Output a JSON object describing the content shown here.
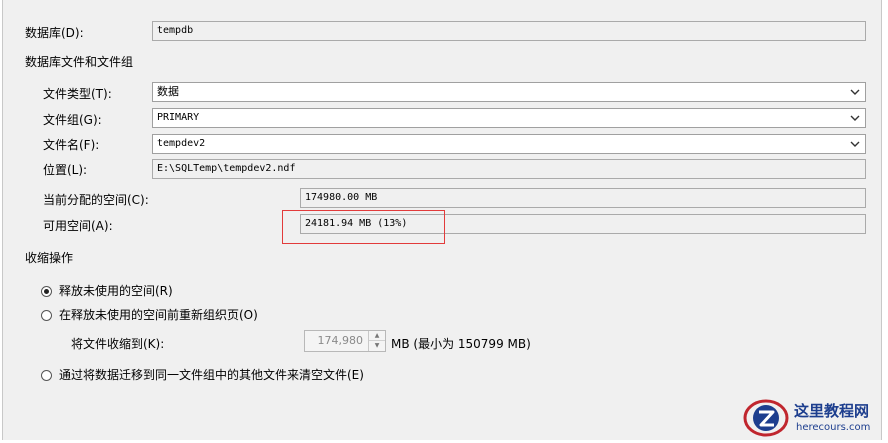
{
  "database": {
    "label": "数据库(D):",
    "value": "tempdb"
  },
  "files_section": {
    "title": "数据库文件和文件组"
  },
  "file_type": {
    "label": "文件类型(T):",
    "value": "数据"
  },
  "filegroup": {
    "label": "文件组(G):",
    "value": "PRIMARY"
  },
  "file_name": {
    "label": "文件名(F):",
    "value": "tempdev2"
  },
  "location": {
    "label": "位置(L):",
    "value": "E:\\SQLTemp\\tempdev2.ndf"
  },
  "allocated": {
    "label": "当前分配的空间(C):",
    "value": "174980.00 MB"
  },
  "available": {
    "label": "可用空间(A):",
    "value": "24181.94 MB (13%)"
  },
  "shrink_section": {
    "title": "收缩操作"
  },
  "options": {
    "release": {
      "label": "释放未使用的空间(R)",
      "selected": true
    },
    "reorganize": {
      "label": "在释放未使用的空间前重新组织页(O)",
      "selected": false
    },
    "shrink_to": {
      "label": "将文件收缩到(K):",
      "value": "174,980",
      "suffix": "MB (最小为 150799 MB)"
    },
    "empty": {
      "label": "通过将数据迁移到同一文件组中的其他文件来清空文件(E)",
      "selected": false
    }
  },
  "watermark": {
    "title": "这里教程网",
    "url": "herecours.com"
  },
  "colors": {
    "highlight": "#e23b3b",
    "panel": "#f0f0f0",
    "logo": "#1d3e8e"
  }
}
